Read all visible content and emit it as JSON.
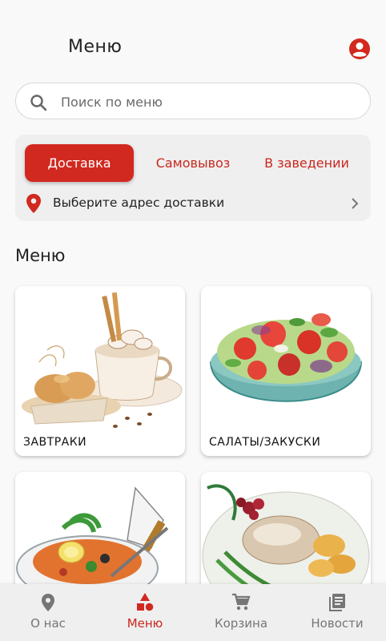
{
  "header": {
    "title": "Меню"
  },
  "search": {
    "placeholder": "Поиск по меню"
  },
  "order_mode": {
    "tabs": [
      "Доставка",
      "Самовывоз",
      "В заведении"
    ],
    "selected": "Доставка",
    "address_prompt": "Выберите адрес доставки"
  },
  "menu_section": {
    "title": "Меню",
    "categories": [
      {
        "label": "ЗАВТРАКИ"
      },
      {
        "label": "САЛАТЫ/ЗАКУСКИ"
      },
      {
        "label": ""
      },
      {
        "label": ""
      }
    ]
  },
  "bottom_nav": {
    "items": [
      {
        "label": "О нас",
        "icon": "location-pin-icon"
      },
      {
        "label": "Меню",
        "icon": "shapes-icon"
      },
      {
        "label": "Корзина",
        "icon": "cart-icon"
      },
      {
        "label": "Новости",
        "icon": "news-icon"
      }
    ],
    "active": "Меню"
  },
  "colors": {
    "accent": "#d1291f",
    "accent_text": "#c8281e",
    "inactive": "#767676",
    "card_bg": "#efefef"
  }
}
